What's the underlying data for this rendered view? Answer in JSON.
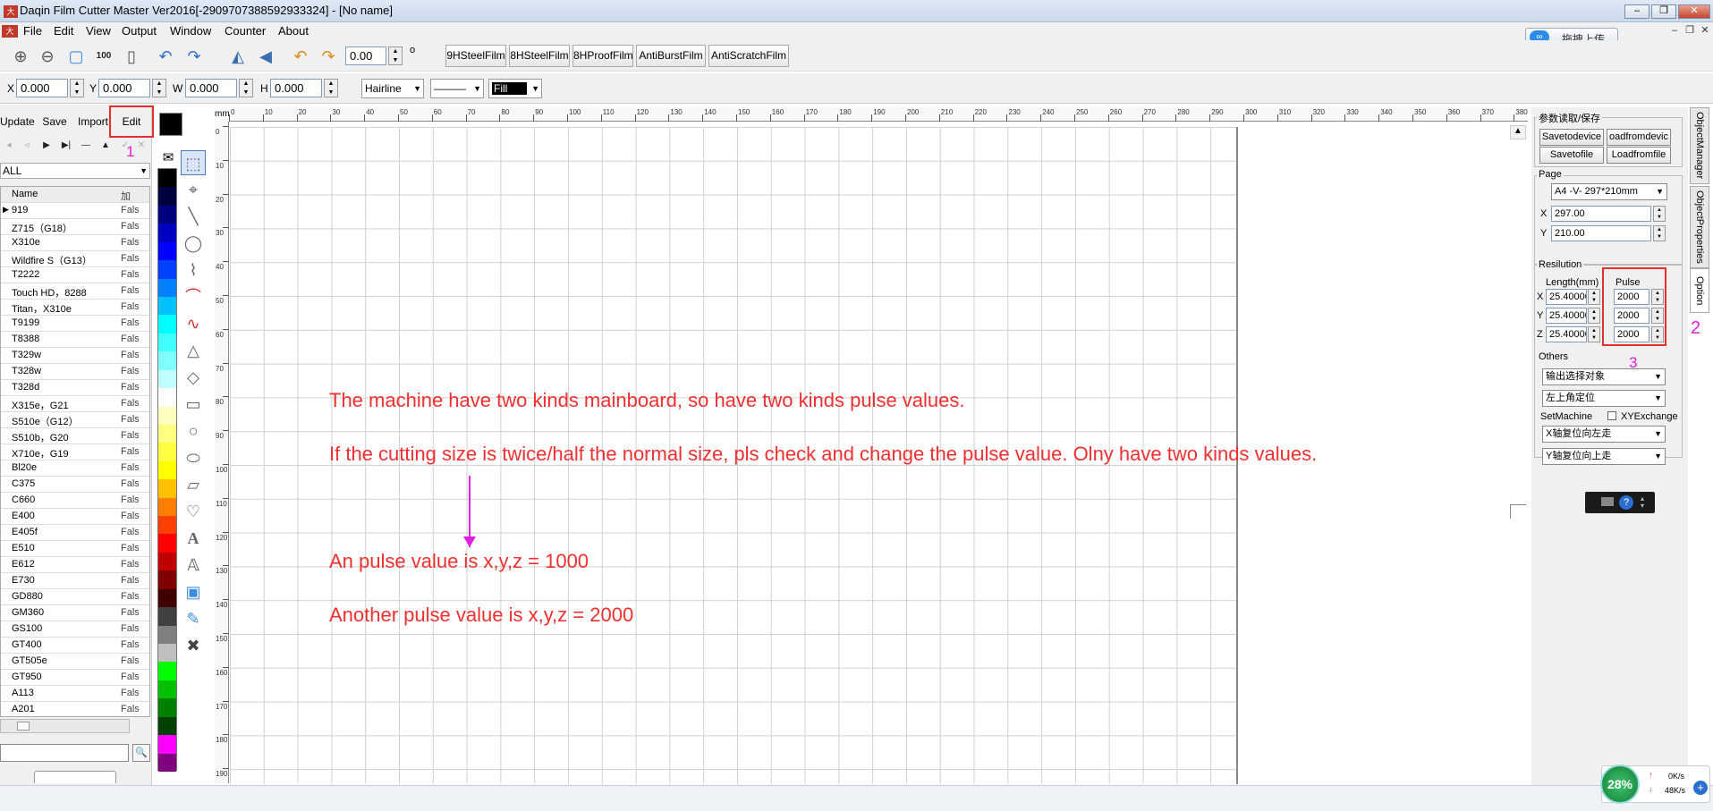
{
  "window": {
    "title": "Daqin Film Cutter Master  Ver2016[-2909707388592933324] - [No name]",
    "icon": "大",
    "min": "–",
    "restore": "❐",
    "close": "✕"
  },
  "menu": [
    "File",
    "Edit",
    "View",
    "Output",
    "Window",
    "Counter",
    "About"
  ],
  "mdi": {
    "min": "–",
    "restore": "❐",
    "close": "✕"
  },
  "baidu": {
    "label": "拖拽上传",
    "logo": "∞"
  },
  "toolbar": {
    "rotate_value": "0.00",
    "degree": "o",
    "films": [
      "9HSteelFilm",
      "8HSteelFilm",
      "8HProofFilm",
      "AntiBurstFilm",
      "AntiScratchFilm"
    ],
    "icons": {
      "zoom_in": "⊕",
      "zoom_out": "⊖",
      "fit": "▢",
      "actual": "100",
      "page": "▯",
      "undo": "↶",
      "redo": "↷",
      "mirror_h": "◭",
      "mirror_v": "◀",
      "rotate_l": "↶",
      "rotate_r": "↷"
    }
  },
  "coords": {
    "x_label": "X",
    "x": "0.000",
    "y_label": "Y",
    "y": "0.000",
    "w_label": "W",
    "w": "0.000",
    "h_label": "H",
    "h": "0.000",
    "line_type": "Hairline",
    "line_style": "———",
    "fill": "Fill"
  },
  "left": {
    "update": "Update",
    "save": "Save",
    "import": "Import",
    "edit": "Edit",
    "annot1": "1",
    "filter": "ALL",
    "col_name": "Name",
    "col_add": "加",
    "rows": [
      {
        "name": "919",
        "v": "Fals"
      },
      {
        "name": "Z715（G18）",
        "v": "Fals"
      },
      {
        "name": "X310e",
        "v": "Fals"
      },
      {
        "name": "Wildfire S（G13）",
        "v": "Fals"
      },
      {
        "name": "T2222",
        "v": "Fals"
      },
      {
        "name": "Touch HD，8288",
        "v": "Fals"
      },
      {
        "name": "Titan，X310e",
        "v": "Fals"
      },
      {
        "name": "T9199",
        "v": "Fals"
      },
      {
        "name": "T8388",
        "v": "Fals"
      },
      {
        "name": "T329w",
        "v": "Fals"
      },
      {
        "name": "T328w",
        "v": "Fals"
      },
      {
        "name": "T328d",
        "v": "Fals"
      },
      {
        "name": "X315e，G21",
        "v": "Fals"
      },
      {
        "name": "S510e（G12）",
        "v": "Fals"
      },
      {
        "name": "S510b，G20",
        "v": "Fals"
      },
      {
        "name": "X710e，G19",
        "v": "Fals"
      },
      {
        "name": "Bl20e",
        "v": "Fals"
      },
      {
        "name": "C375",
        "v": "Fals"
      },
      {
        "name": "C660",
        "v": "Fals"
      },
      {
        "name": "E400",
        "v": "Fals"
      },
      {
        "name": "E405f",
        "v": "Fals"
      },
      {
        "name": "E510",
        "v": "Fals"
      },
      {
        "name": "E612",
        "v": "Fals"
      },
      {
        "name": "E730",
        "v": "Fals"
      },
      {
        "name": "GD880",
        "v": "Fals"
      },
      {
        "name": "GM360",
        "v": "Fals"
      },
      {
        "name": "GS100",
        "v": "Fals"
      },
      {
        "name": "GT400",
        "v": "Fals"
      },
      {
        "name": "GT505e",
        "v": "Fals"
      },
      {
        "name": "GT950",
        "v": "Fals"
      },
      {
        "name": "A113",
        "v": "Fals"
      },
      {
        "name": "A201",
        "v": "Fals"
      }
    ]
  },
  "palette": [
    "#000000",
    "#000040",
    "#000080",
    "#0000c0",
    "#0000ff",
    "#0040ff",
    "#0080ff",
    "#00c0ff",
    "#00ffff",
    "#40ffff",
    "#80ffff",
    "#c0ffff",
    "#ffffff",
    "#ffffc0",
    "#ffff80",
    "#ffff40",
    "#ffff00",
    "#ffc000",
    "#ff8000",
    "#ff4000",
    "#ff0000",
    "#c00000",
    "#800000",
    "#400000",
    "#404040",
    "#808080",
    "#c0c0c0",
    "#00ff00",
    "#00c000",
    "#008000",
    "#004000",
    "#ff00ff",
    "#800080"
  ],
  "rulers": {
    "unit": "mm",
    "h": [
      "0",
      "10",
      "20",
      "30",
      "40",
      "50",
      "60",
      "70",
      "80",
      "90",
      "100",
      "110",
      "120",
      "130",
      "140",
      "150",
      "160",
      "170",
      "180",
      "190",
      "200",
      "210",
      "220",
      "230",
      "240",
      "250",
      "260",
      "270",
      "280",
      "290",
      "300",
      "310",
      "320",
      "330",
      "340",
      "350",
      "360",
      "370",
      "380"
    ],
    "v": [
      "0",
      "10",
      "20",
      "30",
      "40",
      "50",
      "60",
      "70",
      "80",
      "90",
      "100",
      "110",
      "120",
      "130",
      "140",
      "150",
      "160",
      "170",
      "180",
      "190"
    ]
  },
  "notes": {
    "line1": "The machine have two kinds mainboard, so have two kinds  pulse values.",
    "line2": "If the cutting size is twice/half the normal size, pls check and change the pulse value. Olny have two kinds values.",
    "line3": "An pulse value is x,y,z = 1000",
    "line4": "Another pulse value is x,y,z = 2000"
  },
  "right": {
    "param_group": "参数读取/保存",
    "save_device": "Savetodevice",
    "load_device": "oadfromdevic",
    "save_file": "Savetofile",
    "load_file": "Loadfromfile",
    "page_group": "Page",
    "page_size": "A4 -V- 297*210mm",
    "page_x_label": "X",
    "page_x": "297.00",
    "page_y_label": "Y",
    "page_y": "210.00",
    "res_group": "Resilution",
    "length_hdr": "Length(mm)",
    "pulse_hdr": "Pulse",
    "res_x_label": "X",
    "res_x_len": "25.40000",
    "res_x_pulse": "2000",
    "res_y_label": "Y",
    "res_y_len": "25.40000",
    "res_y_pulse": "2000",
    "res_z_label": "Z",
    "res_z_len": "25.40000",
    "res_z_pulse": "2000",
    "annot3": "3",
    "others_group": "Others",
    "other1": "输出选择对象",
    "other2": "左上角定位",
    "setmachine": "SetMachine",
    "xyexchange": "XYExchange",
    "x_reset": "X轴复位向左走",
    "y_reset": "Y轴复位向上走",
    "annot2": "2"
  },
  "vtabs": [
    "ObjectManager",
    "ObjectProperties",
    "Option"
  ],
  "speed": {
    "percent": "28%",
    "up": "0K/s",
    "down": "48K/s"
  }
}
